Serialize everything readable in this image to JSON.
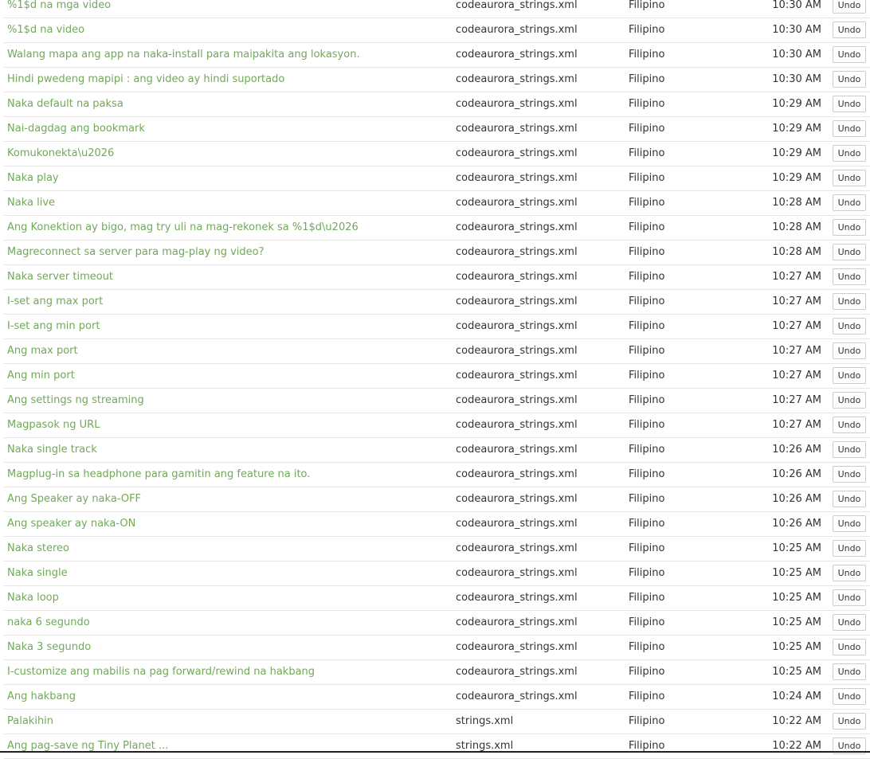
{
  "rows": [
    {
      "source": "%1$d na mga video",
      "file": "codeaurora_strings.xml",
      "language": "Filipino",
      "time": "10:30 AM",
      "action": "Undo"
    },
    {
      "source": "%1$d na video",
      "file": "codeaurora_strings.xml",
      "language": "Filipino",
      "time": "10:30 AM",
      "action": "Undo"
    },
    {
      "source": "Walang mapa ang app na naka-install para maipakita ang lokasyon.",
      "file": "codeaurora_strings.xml",
      "language": "Filipino",
      "time": "10:30 AM",
      "action": "Undo"
    },
    {
      "source": "Hindi pwedeng mapipi : ang video ay hindi suportado",
      "file": "codeaurora_strings.xml",
      "language": "Filipino",
      "time": "10:30 AM",
      "action": "Undo"
    },
    {
      "source": "Naka default na paksa",
      "file": "codeaurora_strings.xml",
      "language": "Filipino",
      "time": "10:29 AM",
      "action": "Undo"
    },
    {
      "source": "Nai-dagdag ang bookmark",
      "file": "codeaurora_strings.xml",
      "language": "Filipino",
      "time": "10:29 AM",
      "action": "Undo"
    },
    {
      "source": "Komukonekta\\u2026",
      "file": "codeaurora_strings.xml",
      "language": "Filipino",
      "time": "10:29 AM",
      "action": "Undo"
    },
    {
      "source": "Naka play",
      "file": "codeaurora_strings.xml",
      "language": "Filipino",
      "time": "10:29 AM",
      "action": "Undo"
    },
    {
      "source": "Naka live",
      "file": "codeaurora_strings.xml",
      "language": "Filipino",
      "time": "10:28 AM",
      "action": "Undo"
    },
    {
      "source": "Ang Konektion ay bigo, mag try uli na mag-rekonek sa %1$d\\u2026",
      "file": "codeaurora_strings.xml",
      "language": "Filipino",
      "time": "10:28 AM",
      "action": "Undo"
    },
    {
      "source": "Magreconnect sa server para mag-play ng video?",
      "file": "codeaurora_strings.xml",
      "language": "Filipino",
      "time": "10:28 AM",
      "action": "Undo"
    },
    {
      "source": "Naka server timeout",
      "file": "codeaurora_strings.xml",
      "language": "Filipino",
      "time": "10:27 AM",
      "action": "Undo"
    },
    {
      "source": "I-set ang max port",
      "file": "codeaurora_strings.xml",
      "language": "Filipino",
      "time": "10:27 AM",
      "action": "Undo"
    },
    {
      "source": "I-set ang min port",
      "file": "codeaurora_strings.xml",
      "language": "Filipino",
      "time": "10:27 AM",
      "action": "Undo"
    },
    {
      "source": "Ang max port",
      "file": "codeaurora_strings.xml",
      "language": "Filipino",
      "time": "10:27 AM",
      "action": "Undo"
    },
    {
      "source": "Ang min port",
      "file": "codeaurora_strings.xml",
      "language": "Filipino",
      "time": "10:27 AM",
      "action": "Undo"
    },
    {
      "source": "Ang settings ng streaming",
      "file": "codeaurora_strings.xml",
      "language": "Filipino",
      "time": "10:27 AM",
      "action": "Undo"
    },
    {
      "source": "Magpasok ng URL",
      "file": "codeaurora_strings.xml",
      "language": "Filipino",
      "time": "10:27 AM",
      "action": "Undo"
    },
    {
      "source": "Naka single track",
      "file": "codeaurora_strings.xml",
      "language": "Filipino",
      "time": "10:26 AM",
      "action": "Undo"
    },
    {
      "source": "Magplug-in sa headphone para gamitin ang feature na ito.",
      "file": "codeaurora_strings.xml",
      "language": "Filipino",
      "time": "10:26 AM",
      "action": "Undo"
    },
    {
      "source": "Ang Speaker ay naka-OFF",
      "file": "codeaurora_strings.xml",
      "language": "Filipino",
      "time": "10:26 AM",
      "action": "Undo"
    },
    {
      "source": "Ang speaker ay naka-ON",
      "file": "codeaurora_strings.xml",
      "language": "Filipino",
      "time": "10:26 AM",
      "action": "Undo"
    },
    {
      "source": "Naka stereo",
      "file": "codeaurora_strings.xml",
      "language": "Filipino",
      "time": "10:25 AM",
      "action": "Undo"
    },
    {
      "source": "Naka single",
      "file": "codeaurora_strings.xml",
      "language": "Filipino",
      "time": "10:25 AM",
      "action": "Undo"
    },
    {
      "source": "Naka loop",
      "file": "codeaurora_strings.xml",
      "language": "Filipino",
      "time": "10:25 AM",
      "action": "Undo"
    },
    {
      "source": "naka 6 segundo",
      "file": "codeaurora_strings.xml",
      "language": "Filipino",
      "time": "10:25 AM",
      "action": "Undo"
    },
    {
      "source": "Naka 3 segundo",
      "file": "codeaurora_strings.xml",
      "language": "Filipino",
      "time": "10:25 AM",
      "action": "Undo"
    },
    {
      "source": "I-customize ang mabilis na pag forward/rewind na hakbang",
      "file": "codeaurora_strings.xml",
      "language": "Filipino",
      "time": "10:25 AM",
      "action": "Undo"
    },
    {
      "source": "Ang hakbang",
      "file": "codeaurora_strings.xml",
      "language": "Filipino",
      "time": "10:24 AM",
      "action": "Undo"
    },
    {
      "source": "Palakihin",
      "file": "strings.xml",
      "language": "Filipino",
      "time": "10:22 AM",
      "action": "Undo"
    },
    {
      "source": "Ang pag-save ng Tiny Planet ...",
      "file": "strings.xml",
      "language": "Filipino",
      "time": "10:22 AM",
      "action": "Undo"
    }
  ]
}
